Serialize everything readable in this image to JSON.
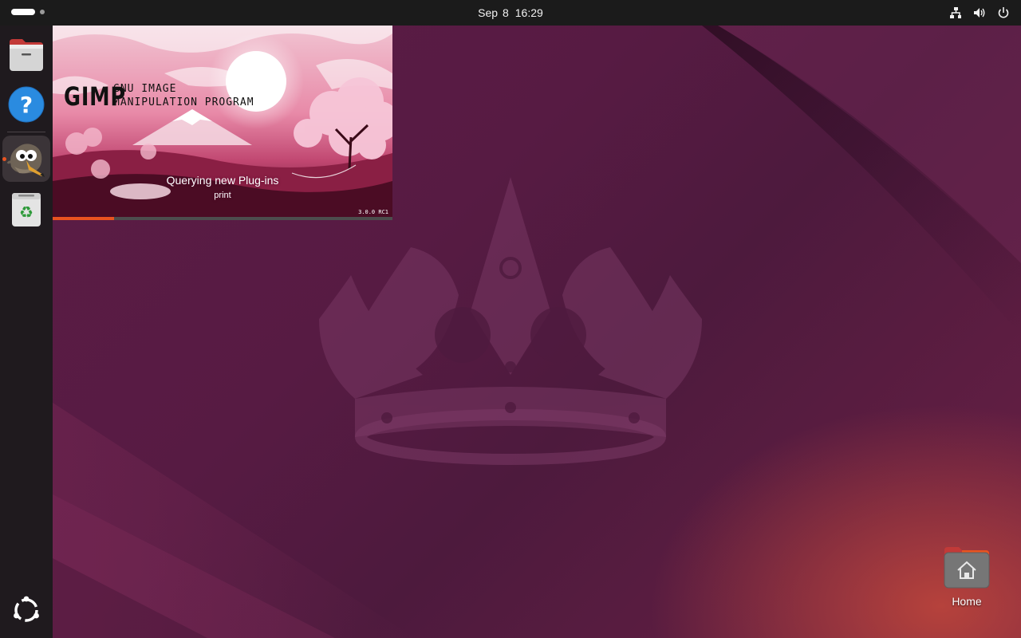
{
  "topbar": {
    "date": "Sep 8",
    "time": "16:29",
    "tray_icons": [
      "network-icon",
      "volume-icon",
      "power-icon"
    ]
  },
  "dock": {
    "items": [
      {
        "name": "files",
        "icon": "folder-icon"
      },
      {
        "name": "help",
        "icon": "help-icon"
      },
      {
        "name": "gimp",
        "icon": "gimp-icon",
        "running": true,
        "active": true
      },
      {
        "name": "trash",
        "icon": "trash-icon"
      }
    ],
    "show_apps_icon": "ubuntu-logo-icon"
  },
  "splash": {
    "logo": "GIMP",
    "subtitle_line1": "GNU IMAGE",
    "subtitle_line2": "MANIPULATION PROGRAM",
    "status": "Querying new Plug-ins",
    "detail": "print",
    "version": "3.0.0 RC1",
    "progress": 0.18,
    "accent_color": "#e95420"
  },
  "desktop": {
    "icons": [
      {
        "label": "Home",
        "icon": "home-folder-icon"
      }
    ]
  },
  "colors": {
    "accent": "#e95420",
    "topbar": "#1b1b1b",
    "dock": "#1f1a1e"
  }
}
